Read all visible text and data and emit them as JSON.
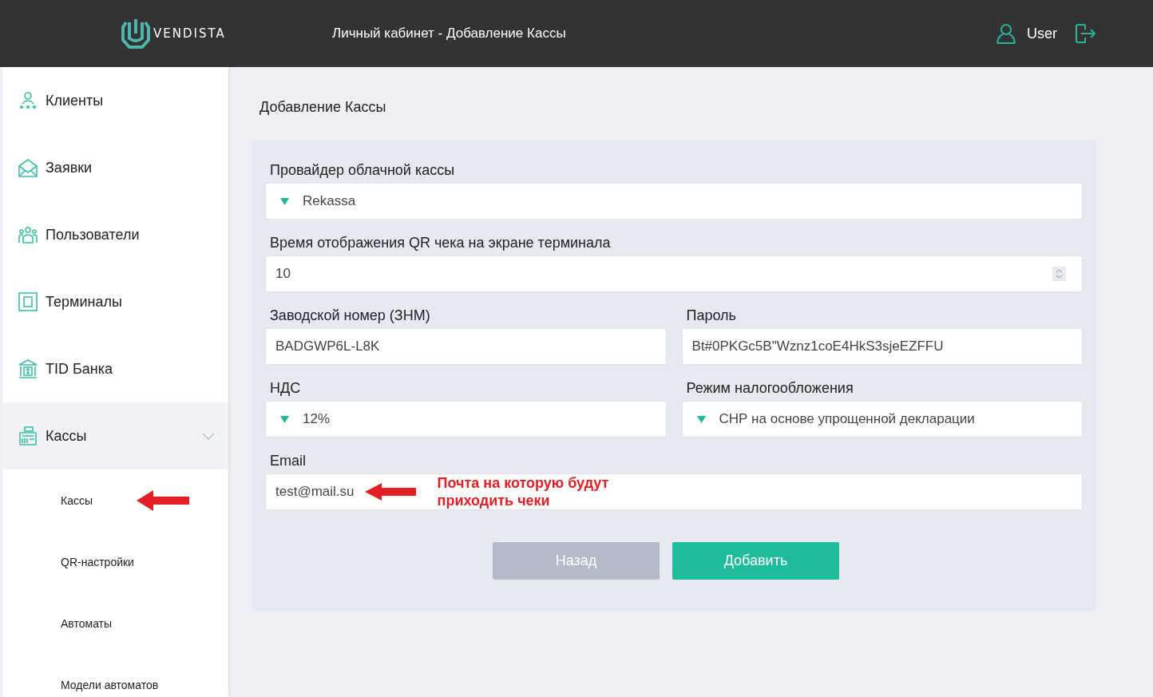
{
  "header": {
    "logo_text": "VENDISTA",
    "title": "Личный кабинет - Добавление Кассы",
    "user": "User"
  },
  "sidebar": {
    "items": [
      {
        "label": "Клиенты",
        "expanded": false
      },
      {
        "label": "Заявки",
        "expanded": false
      },
      {
        "label": "Пользователи",
        "expanded": false
      },
      {
        "label": "Терминалы",
        "expanded": false
      },
      {
        "label": "TID Банка",
        "expanded": false
      },
      {
        "label": "Кассы",
        "expanded": true,
        "children": [
          {
            "label": "Кассы",
            "marked": true
          },
          {
            "label": "QR-настройки",
            "marked": false
          },
          {
            "label": "Автоматы",
            "marked": false
          },
          {
            "label": "Модели автоматов",
            "marked": false
          }
        ]
      }
    ]
  },
  "form": {
    "title": "Добавление Кассы",
    "rows": [
      [
        {
          "kind": "select",
          "label": "Провайдер облачной кассы",
          "value": "Rekassa"
        }
      ],
      [
        {
          "kind": "number",
          "label": "Время отображения QR чека на экране терминала",
          "value": "10"
        }
      ],
      [
        {
          "kind": "text",
          "label": "Заводской номер (ЗНМ)",
          "value": "BADGWP6L-L8K"
        },
        {
          "kind": "text",
          "label": "Пароль",
          "value": "Bt#0PKGc5B\"Wznz1coE4HkS3sjeEZFFU"
        }
      ],
      [
        {
          "kind": "select",
          "label": "НДС",
          "value": "12%"
        },
        {
          "kind": "select",
          "label": "Режим налогообложения",
          "value": "СНР на основе упрощенной декларации"
        }
      ],
      [
        {
          "kind": "text",
          "label": "Email",
          "value": "test@mail.su",
          "note": "Почта на которую будут приходить чеки"
        }
      ]
    ],
    "buttons": [
      {
        "kind": "secondary",
        "label": "Назад"
      },
      {
        "kind": "primary",
        "label": "Добавить"
      }
    ]
  }
}
